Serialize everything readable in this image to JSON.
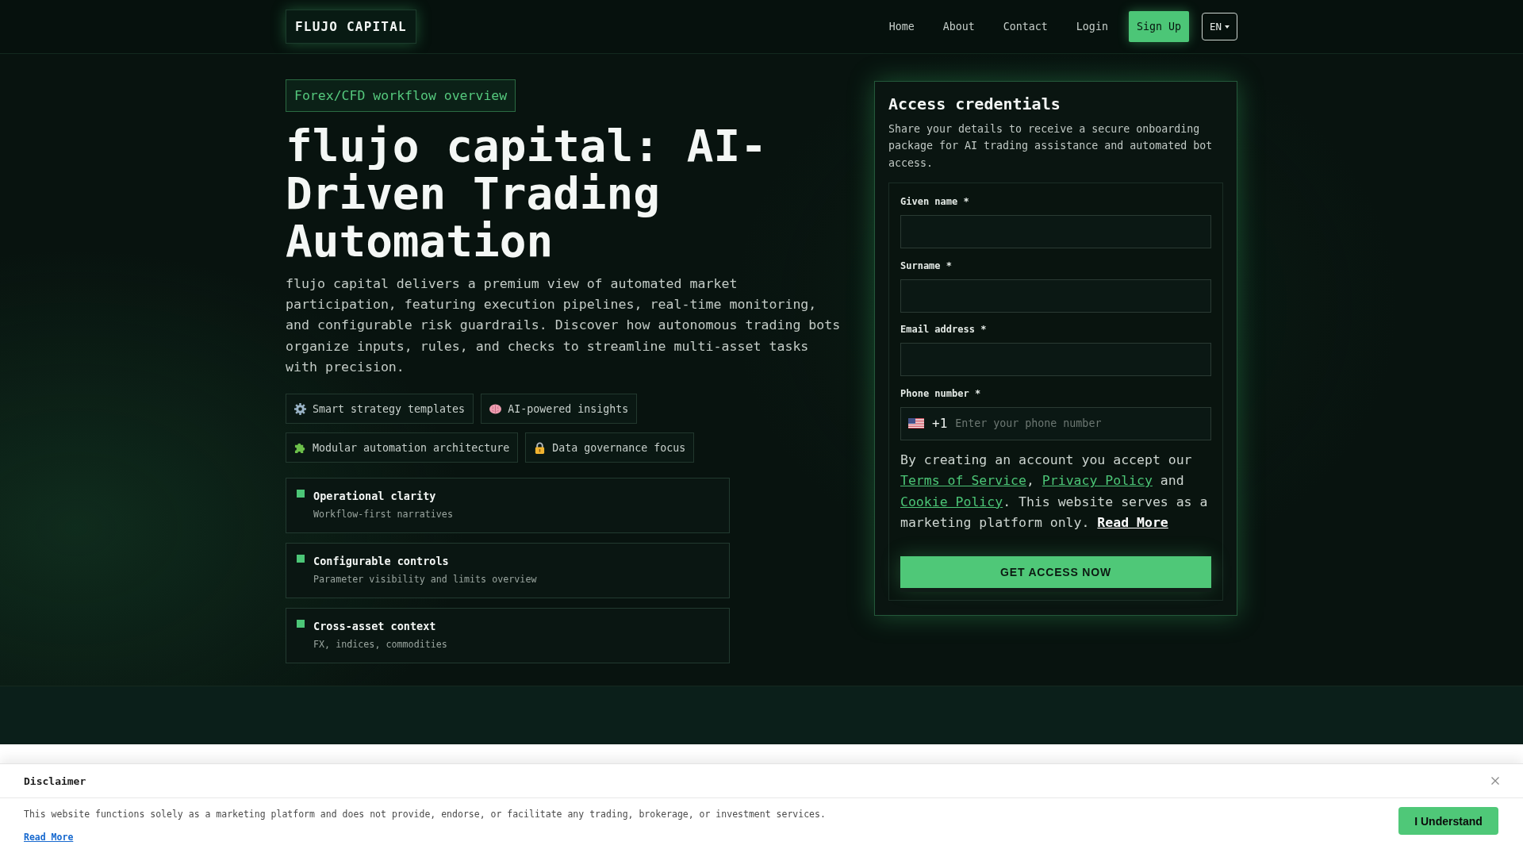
{
  "header": {
    "logo": "FLUJO CAPITAL",
    "nav": [
      {
        "label": "Home"
      },
      {
        "label": "About"
      },
      {
        "label": "Contact"
      },
      {
        "label": "Login"
      }
    ],
    "signup_button": "Sign Up",
    "language": "EN"
  },
  "hero": {
    "tag": "Forex/CFD workflow overview",
    "title": "flujo capital: AI-Driven Trading Automation",
    "description": "flujo capital delivers a premium view of automated market participation, featuring execution pipelines, real-time monitoring, and configurable risk guardrails. Discover how autonomous trading bots organize inputs, rules, and checks to streamline multi-asset tasks with precision.",
    "chips": [
      {
        "kind": "gear",
        "label": "Smart strategy templates"
      },
      {
        "kind": "brain",
        "label": "AI-powered insights"
      },
      {
        "kind": "puzzle",
        "label": "Modular automation architecture"
      },
      {
        "kind": "lock",
        "label": "Data governance focus"
      }
    ],
    "features": [
      {
        "title": "Operational clarity",
        "subtitle": "Workflow-first narratives"
      },
      {
        "title": "Configurable controls",
        "subtitle": "Parameter visibility and limits overview"
      },
      {
        "title": "Cross-asset context",
        "subtitle": "FX, indices, commodities"
      }
    ]
  },
  "form": {
    "title": "Access credentials",
    "description": "Share your details to receive a secure onboarding package for AI trading assistance and automated bot access.",
    "fields": [
      {
        "kind": "text",
        "label": "Given name *"
      },
      {
        "kind": "text",
        "label": "Surname *"
      },
      {
        "kind": "text",
        "label": "Email address *"
      },
      {
        "kind": "phone",
        "label": "Phone number *",
        "country_code": "+1",
        "placeholder": "Enter your phone number"
      }
    ],
    "consent": [
      {
        "kind": "text",
        "text": "By creating an account you accept our "
      },
      {
        "kind": "link",
        "text": "Terms of Service"
      },
      {
        "kind": "text",
        "text": ", "
      },
      {
        "kind": "link",
        "text": "Privacy Policy"
      },
      {
        "kind": "text",
        "text": " and "
      },
      {
        "kind": "link",
        "text": "Cookie Policy"
      },
      {
        "kind": "text",
        "text": ". This website serves as a marketing platform only. "
      },
      {
        "kind": "read_more",
        "text": "Read More"
      }
    ],
    "submit": "GET ACCESS NOW"
  },
  "disclaimer": {
    "title": "Disclaimer",
    "text": "This website functions solely as a marketing platform and does not provide, endorse, or facilitate any trading, brokerage, or investment services.",
    "read_more": "Read More",
    "button": "I Understand"
  }
}
